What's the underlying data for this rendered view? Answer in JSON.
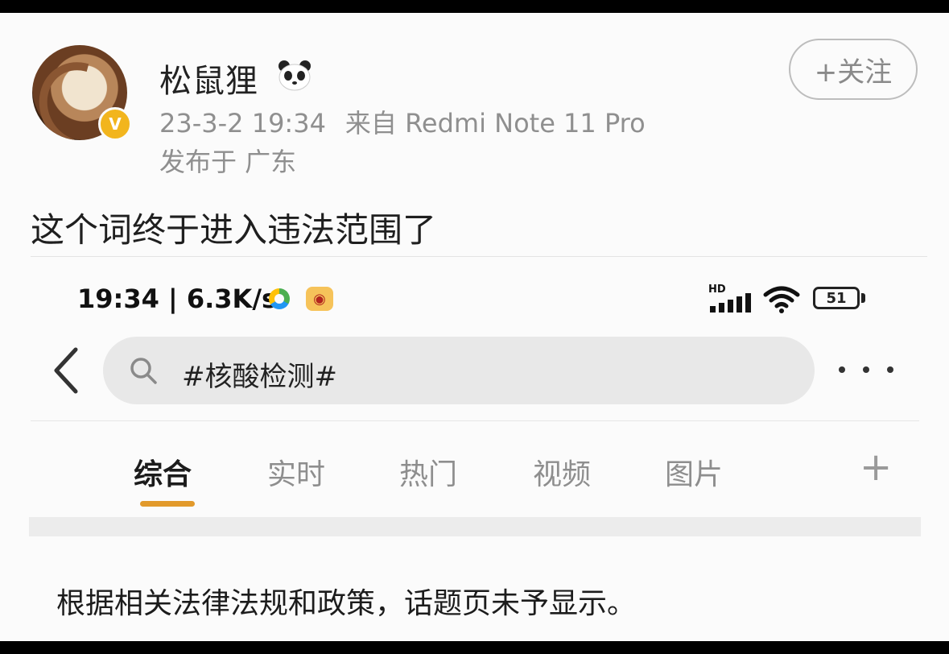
{
  "post": {
    "username": "松鼠狸",
    "timestamp": "23-3-2 19:34",
    "source": "来自 Redmi Note 11 Pro",
    "location": "发布于 广东",
    "follow_label": "+关注",
    "text": "这个词终于进入违法范围了",
    "icons": [
      "avatar",
      "verified-badge-icon",
      "panda-icon"
    ]
  },
  "screenshot": {
    "status_bar": {
      "time_speed": "19:34 | 6.3K/s",
      "hd": "HD",
      "battery": "51",
      "icons": [
        "app-notification-icon",
        "weibo-notification-icon",
        "signal-icon",
        "wifi-icon",
        "battery-icon"
      ]
    },
    "search": {
      "query": "#核酸检测#",
      "icons": [
        "back-icon",
        "search-icon",
        "more-icon"
      ]
    },
    "tabs": [
      {
        "label": "综合",
        "active": true
      },
      {
        "label": "实时",
        "active": false
      },
      {
        "label": "热门",
        "active": false
      },
      {
        "label": "视频",
        "active": false
      },
      {
        "label": "图片",
        "active": false
      }
    ],
    "tab_add": "+",
    "notice": "根据相关法律法规和政策，话题页未予显示。"
  },
  "colors": {
    "accent_underline": "#e29a2b",
    "verified_badge": "#f2b51d",
    "meta_text": "#8f8f8f"
  }
}
